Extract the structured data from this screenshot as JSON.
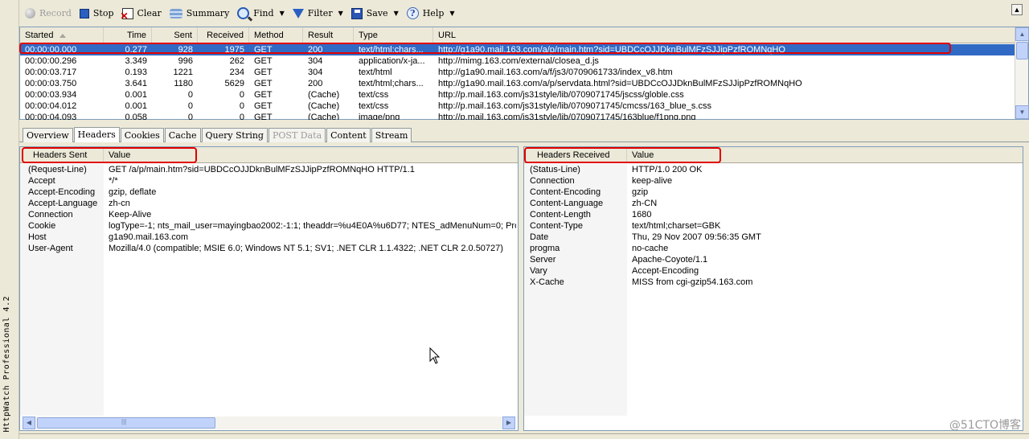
{
  "app": {
    "product_label": "HttpWatch Professional 4.2"
  },
  "toolbar": {
    "record": "Record",
    "stop": "Stop",
    "clear": "Clear",
    "summary": "Summary",
    "find": "Find",
    "filter": "Filter",
    "save": "Save",
    "help": "Help"
  },
  "grid": {
    "columns": [
      "Started",
      "Time",
      "Sent",
      "Received",
      "Method",
      "Result",
      "Type",
      "URL"
    ],
    "rows": [
      {
        "started": "00:00:00.000",
        "time": "0.277",
        "sent": "928",
        "received": "1975",
        "method": "GET",
        "result": "200",
        "type": "text/html;chars...",
        "url": "http://g1a90.mail.163.com/a/p/main.htm?sid=UBDCcOJJDknBulMFzSJJipPzfROMNqHO"
      },
      {
        "started": "00:00:00.296",
        "time": "3.349",
        "sent": "996",
        "received": "262",
        "method": "GET",
        "result": "304",
        "type": "application/x-ja...",
        "url": "http://mimg.163.com/external/closea_d.js"
      },
      {
        "started": "00:00:03.717",
        "time": "0.193",
        "sent": "1221",
        "received": "234",
        "method": "GET",
        "result": "304",
        "type": "text/html",
        "url": "http://g1a90.mail.163.com/a/f/js3/0709061733/index_v8.htm"
      },
      {
        "started": "00:00:03.750",
        "time": "3.641",
        "sent": "1180",
        "received": "5629",
        "method": "GET",
        "result": "200",
        "type": "text/html;chars...",
        "url": "http://g1a90.mail.163.com/a/p/servdata.html?sid=UBDCcOJJDknBulMFzSJJipPzfROMNqHO"
      },
      {
        "started": "00:00:03.934",
        "time": "0.001",
        "sent": "0",
        "received": "0",
        "method": "GET",
        "result": "(Cache)",
        "type": "text/css",
        "url": "http://p.mail.163.com/js31style/lib/0709071745/jscss/globle.css"
      },
      {
        "started": "00:00:04.012",
        "time": "0.001",
        "sent": "0",
        "received": "0",
        "method": "GET",
        "result": "(Cache)",
        "type": "text/css",
        "url": "http://p.mail.163.com/js31style/lib/0709071745/cmcss/163_blue_s.css"
      },
      {
        "started": "00:00:04.093",
        "time": "0.058",
        "sent": "0",
        "received": "0",
        "method": "GET",
        "result": "(Cache)",
        "type": "image/png",
        "url": "http://p.mail.163.com/js31style/lib/0709071745/163blue/f1png.png"
      }
    ]
  },
  "tabs": [
    "Overview",
    "Headers",
    "Cookies",
    "Cache",
    "Query String",
    "POST Data",
    "Content",
    "Stream"
  ],
  "headers_sent": {
    "col_name": "Headers Sent",
    "col_value": "Value",
    "rows": [
      {
        "name": "(Request-Line)",
        "value": "GET /a/p/main.htm?sid=UBDCcOJJDknBulMFzSJJipPzfROMNqHO HTTP/1.1"
      },
      {
        "name": "Accept",
        "value": "*/*"
      },
      {
        "name": "Accept-Encoding",
        "value": "gzip, deflate"
      },
      {
        "name": "Accept-Language",
        "value": "zh-cn"
      },
      {
        "name": "Connection",
        "value": "Keep-Alive"
      },
      {
        "name": "Cookie",
        "value": "logType=-1; nts_mail_user=mayingbao2002:-1:1; theaddr=%u4E0A%u6D77; NTES_adMenuNum=0; Pro"
      },
      {
        "name": "Host",
        "value": "g1a90.mail.163.com"
      },
      {
        "name": "User-Agent",
        "value": "Mozilla/4.0 (compatible; MSIE 6.0; Windows NT 5.1; SV1; .NET CLR 1.1.4322; .NET CLR 2.0.50727)"
      }
    ]
  },
  "headers_received": {
    "col_name": "Headers Received",
    "col_value": "Value",
    "rows": [
      {
        "name": "(Status-Line)",
        "value": "HTTP/1.0 200 OK"
      },
      {
        "name": "Connection",
        "value": "keep-alive"
      },
      {
        "name": "Content-Encoding",
        "value": "gzip"
      },
      {
        "name": "Content-Language",
        "value": "zh-CN"
      },
      {
        "name": "Content-Length",
        "value": "1680"
      },
      {
        "name": "Content-Type",
        "value": "text/html;charset=GBK"
      },
      {
        "name": "Date",
        "value": "Thu, 29 Nov 2007 09:56:35 GMT"
      },
      {
        "name": "progma",
        "value": "no-cache"
      },
      {
        "name": "Server",
        "value": "Apache-Coyote/1.1"
      },
      {
        "name": "Vary",
        "value": "Accept-Encoding"
      },
      {
        "name": "X-Cache",
        "value": "MISS from cgi-gzip54.163.com"
      }
    ]
  },
  "watermark": "@51CTO博客",
  "colors": {
    "selection": "#316ac5",
    "annotation": "#e10000",
    "chrome": "#ece9d8"
  }
}
